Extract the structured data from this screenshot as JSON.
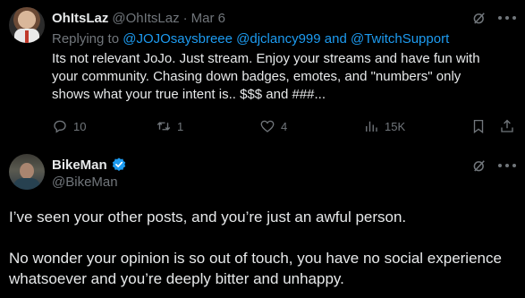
{
  "tweet1": {
    "display_name": "OhItsLaz",
    "handle": "@OhItsLaz",
    "separator": "·",
    "time": "Mar 6",
    "replying_to_label": "Replying to",
    "mentions": "@JOJOsaysbreee @djclancy999 and @TwitchSupport",
    "text": "Its not relevant JoJo.   Just stream.  Enjoy your streams and have fun with your community.  Chasing down badges, emotes, and \"numbers\" only shows what your true intent is.. $$$ and ###...",
    "actions": {
      "replies": "10",
      "reposts": "1",
      "likes": "4",
      "views": "15K"
    }
  },
  "tweet2": {
    "display_name": "BikeMan",
    "handle": "@BikeMan",
    "paragraph1": "I’ve seen your other posts, and you’re just an awful person.",
    "paragraph2": "No wonder your opinion is so out of touch, you have no social experience whatsoever and you’re deeply bitter and unhappy."
  },
  "colors": {
    "background": "#000000",
    "text": "#e7e9ea",
    "muted": "#71767b",
    "accent": "#1d9bf0"
  },
  "icons": [
    "grok-icon",
    "more-icon",
    "reply-icon",
    "repost-icon",
    "like-icon",
    "views-icon",
    "bookmark-icon",
    "share-icon",
    "verified-badge-icon"
  ]
}
